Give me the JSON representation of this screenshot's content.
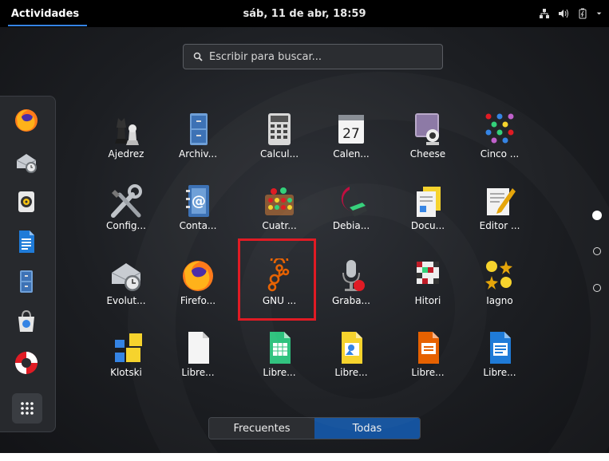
{
  "topbar": {
    "activities_label": "Actividades",
    "clock": "sáb, 11 de abr, 18:59"
  },
  "search": {
    "placeholder": "Escribir para buscar..."
  },
  "dash": {
    "items": [
      "firefox-icon",
      "evolution-icon",
      "rhythmbox-icon",
      "writer-icon",
      "files-icon",
      "software-icon",
      "help-icon"
    ]
  },
  "apps": [
    {
      "label": "Ajedrez"
    },
    {
      "label": "Archiv..."
    },
    {
      "label": "Calcul..."
    },
    {
      "label": "Calen..."
    },
    {
      "label": "Cheese"
    },
    {
      "label": "Cinco ..."
    },
    {
      "label": "Config..."
    },
    {
      "label": "Conta..."
    },
    {
      "label": "Cuatr..."
    },
    {
      "label": "Debia..."
    },
    {
      "label": "Docu..."
    },
    {
      "label": "Editor ..."
    },
    {
      "label": "Evolut..."
    },
    {
      "label": "Firefo..."
    },
    {
      "label": "GNU ..."
    },
    {
      "label": "Graba..."
    },
    {
      "label": "Hitori"
    },
    {
      "label": "Iagno"
    },
    {
      "label": "Klotski"
    },
    {
      "label": "Libre..."
    },
    {
      "label": "Libre..."
    },
    {
      "label": "Libre..."
    },
    {
      "label": "Libre..."
    },
    {
      "label": "Libre..."
    }
  ],
  "calendar_day": "27",
  "view_toggle": {
    "frequent": "Frecuentes",
    "all": "Todas",
    "active": "Todas"
  },
  "colors": {
    "highlight": "#e01b24",
    "accent": "#15539e"
  }
}
